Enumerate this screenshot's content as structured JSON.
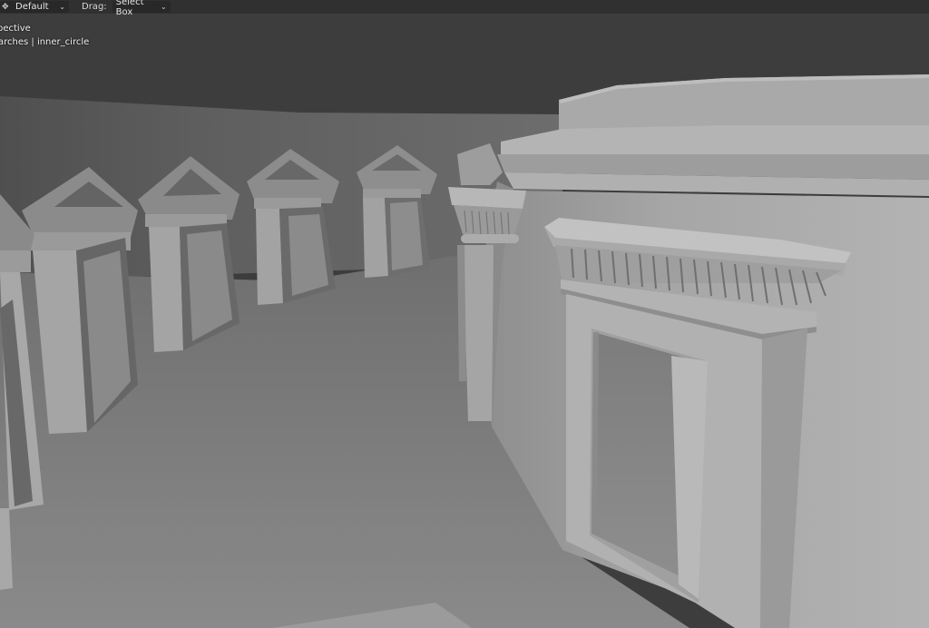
{
  "header": {
    "orientation_value": "Default",
    "orientation_icon": "transform-orientation-icon",
    "drag_label": "Drag:",
    "drag_value": "Select Box",
    "caret_icon": "chevron-down-icon"
  },
  "viewport_overlay": {
    "view_name": "pective",
    "collection_object": "arches | inner_circle"
  },
  "colors": {
    "header_bg": "#303030",
    "dropdown_bg": "#282828",
    "viewport_bg": "#3d3d3d",
    "floor": "#7a7a7a",
    "wall": "#5c5c5c",
    "mesh_light": "#a8a8a8",
    "mesh_dark": "#6a6a6a"
  }
}
